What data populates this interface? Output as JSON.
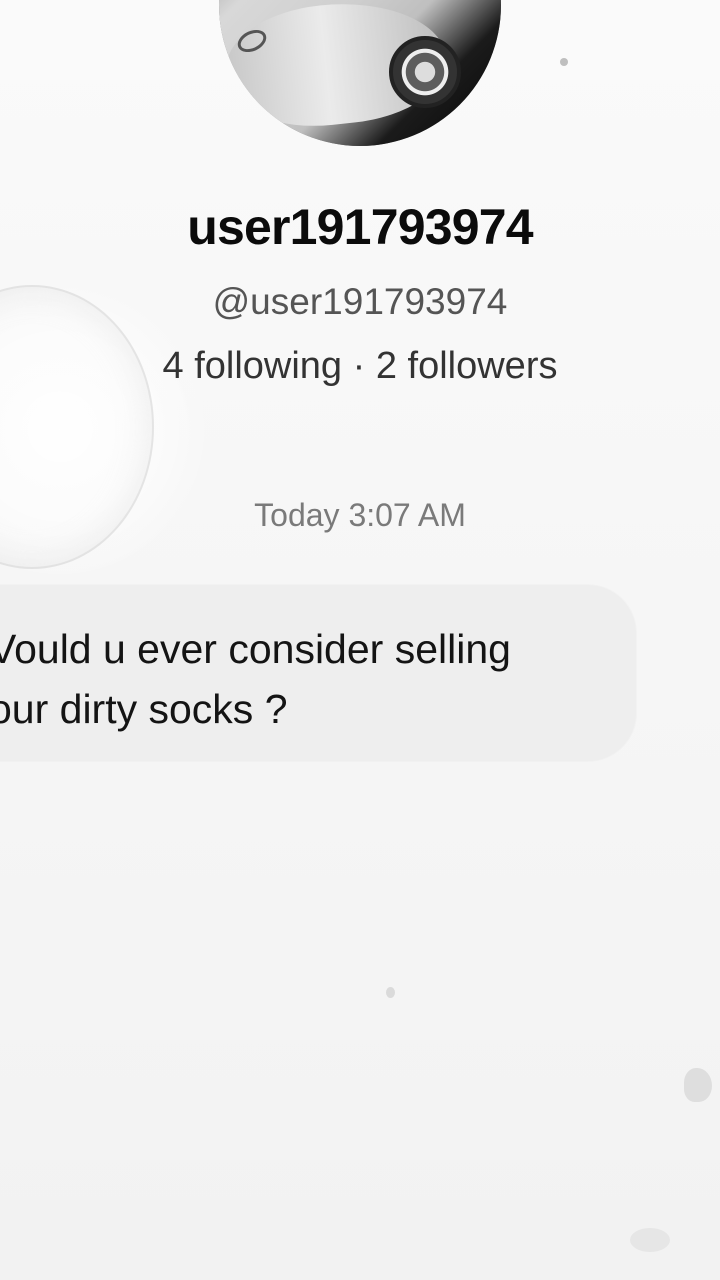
{
  "profile": {
    "display_name": "user191793974",
    "handle": "@user191793974",
    "stats": "4 following · 2 followers",
    "avatar_icon": "profile-avatar-image"
  },
  "conversation": {
    "timestamp": "Today 3:07 AM",
    "message": "Vould u ever consider selling\nour dirty socks ?"
  },
  "colors": {
    "background": "#f7f7f7",
    "bubble": "#eeeeee",
    "text": "#111111"
  }
}
